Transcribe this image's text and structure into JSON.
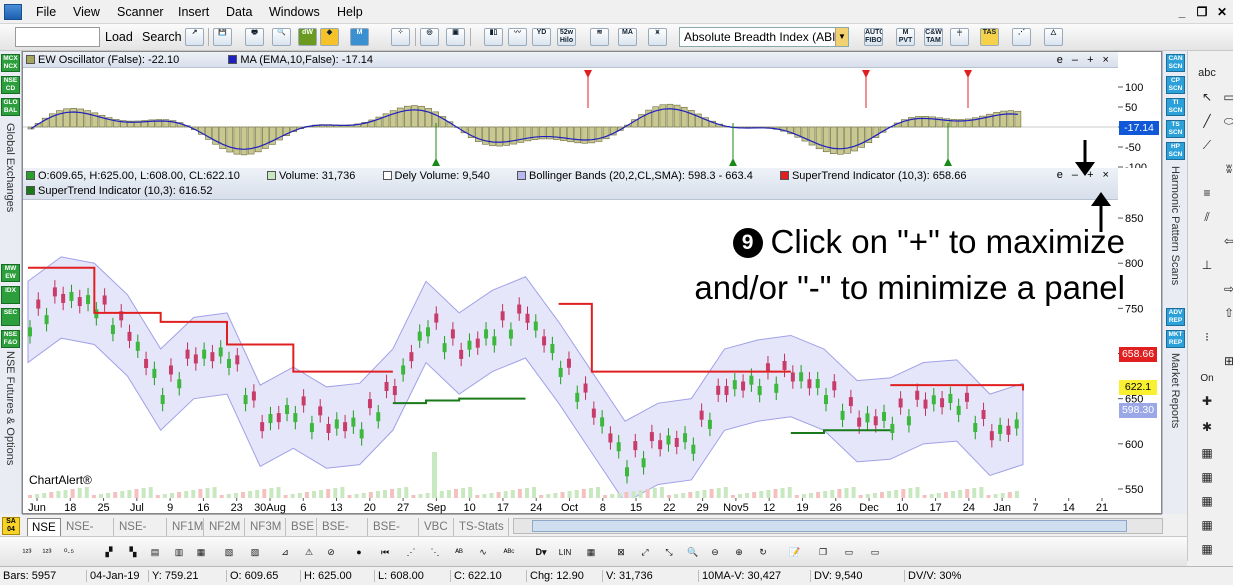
{
  "menu": {
    "items": [
      "File",
      "View",
      "Scanner",
      "Insert",
      "Data",
      "Windows",
      "Help"
    ],
    "window_controls": [
      "minimize-icon",
      "restore-icon",
      "close-icon"
    ]
  },
  "toolbar": {
    "symbol_value": "",
    "load_label": "Load",
    "search_label": "Search",
    "indicator_select": "Absolute Breadth Index (ABI",
    "icons": [
      "dW",
      "M",
      "52w Hilo",
      "MA",
      "AUTO FIBO",
      "M PVT",
      "C&W TAM",
      "TAS"
    ]
  },
  "left_strip": {
    "buttons": [
      "MCX NCX",
      "NSE CD",
      "GLO BAL",
      "MW EW",
      "IDX",
      "SEC",
      "NSE F&O"
    ],
    "labels": [
      "Global Exchanges",
      "NSE Futures & Options"
    ],
    "bottom_button": "SA 04"
  },
  "oscillator_panel": {
    "items": [
      {
        "label": "EW Oscillator (False): -22.10",
        "color": "#a4a45c"
      },
      {
        "label": "MA (EMA,10,False): -17.14",
        "color": "#2020c0"
      }
    ],
    "controls": "e – + ×",
    "y_ticks": [
      "100",
      "50",
      "0",
      "-50",
      "-100"
    ],
    "current_value": "-17.14"
  },
  "price_panel": {
    "items": [
      {
        "label": "O:609.65, H:625.00, L:608.00, CL:622.10",
        "color": "#2aa02a"
      },
      {
        "label": "Volume: 31,736",
        "color": "#c8e8c0"
      },
      {
        "label": "Dely Volume: 9,540",
        "color": "#ffffff"
      },
      {
        "label": "Bollinger Bands (20,2,CL,SMA): 598.3 - 663.4",
        "color": "#b8b8f0"
      },
      {
        "label": "SuperTrend Indicator (10,3): 658.66",
        "color": "#e02020"
      },
      {
        "label": "SuperTrend Indicator (10,3): 616.52",
        "color": "#1a7a1a"
      }
    ],
    "controls": "e – + ×",
    "y_ticks": [
      "850",
      "800",
      "750",
      "700",
      "650",
      "600",
      "550"
    ],
    "tags": {
      "supertrend": "658.66",
      "close": "622.1",
      "bb_lower": "598.30"
    },
    "watermark": "ChartAlert®"
  },
  "annotation": {
    "bullet": "9",
    "line1": "Click on \"+\" to maximize",
    "line2": "and/or \"-\" to minimize a panel"
  },
  "x_axis": [
    "Jun",
    "18",
    "25",
    "Jul",
    "9",
    "16",
    "23",
    "30Aug",
    "6",
    "13",
    "20",
    "27",
    "Sep",
    "10",
    "17",
    "24",
    "Oct",
    "8",
    "15",
    "22",
    "29",
    "Nov5",
    "12",
    "19",
    "26",
    "Dec",
    "10",
    "17",
    "24",
    "Jan",
    "7",
    "14",
    "21"
  ],
  "tabs": [
    "NSE",
    "NSE-HA",
    "NSE-RP",
    "NF1M",
    "NF2M",
    "NF3M",
    "BSE",
    "BSE-HA",
    "BSE-RP",
    "VBC",
    "TS-Stats"
  ],
  "right_strip": {
    "buttons": [
      "CAN SCN",
      "CP SCN",
      "TI SCN",
      "TS SCN",
      "HP SCN",
      "ADV REP",
      "MKT REP"
    ],
    "labels": [
      "Harmonic Pattern Scans",
      "Market Reports"
    ]
  },
  "tools": [
    "abc",
    "cursor-icon",
    "rectangle-icon",
    "ellipse-icon",
    "line-icon",
    "trendline-icon",
    "ew-icon",
    "fib-icon",
    "arrow-icon",
    "grid-icon",
    "On"
  ],
  "status": {
    "bars": "Bars: 5957",
    "date": "04-Jan-19",
    "y": "Y: 759.21",
    "o": "O: 609.65",
    "h": "H: 625.00",
    "l": "L: 608.00",
    "c": "C: 622.10",
    "chg": "Chg: 12.90",
    "v": "V: 31,736",
    "mav": "10MA-V: 30,427",
    "dv": "DV: 9,540",
    "dvv": "DV/V: 30%"
  },
  "chart_data": {
    "type": "candlestick",
    "x": [
      "Jun",
      "18",
      "25",
      "Jul",
      "9",
      "16",
      "23",
      "30Aug",
      "6",
      "13",
      "20",
      "27",
      "Sep",
      "10",
      "17",
      "24",
      "Oct",
      "8",
      "15",
      "22",
      "29",
      "Nov5",
      "12",
      "19",
      "26",
      "Dec",
      "10",
      "17",
      "24",
      "Jan",
      "7",
      "14",
      "21"
    ],
    "close": [
      735,
      762,
      755,
      720,
      660,
      695,
      700,
      620,
      640,
      618,
      622,
      660,
      735,
      700,
      725,
      740,
      690,
      635,
      580,
      600,
      605,
      660,
      670,
      675,
      660,
      625,
      628,
      645,
      648,
      610,
      622
    ],
    "supertrend_upper": [
      795,
      795,
      745,
      745,
      735,
      735,
      710,
      710,
      680,
      680,
      680,
      680,
      null,
      null,
      null,
      null,
      755,
      680,
      680,
      680,
      680,
      680,
      680,
      680,
      null,
      null,
      665,
      665,
      665,
      665,
      659
    ],
    "supertrend_lower": [
      null,
      null,
      null,
      null,
      null,
      null,
      null,
      null,
      null,
      null,
      null,
      645,
      648,
      650,
      650,
      650,
      null,
      null,
      null,
      null,
      null,
      null,
      null,
      612,
      615,
      615,
      615,
      null,
      null,
      null,
      null
    ],
    "ylim": [
      540,
      870
    ],
    "oscillator": {
      "ylim": [
        -100,
        100
      ],
      "last": -22.1,
      "ma_last": -17.14
    }
  }
}
